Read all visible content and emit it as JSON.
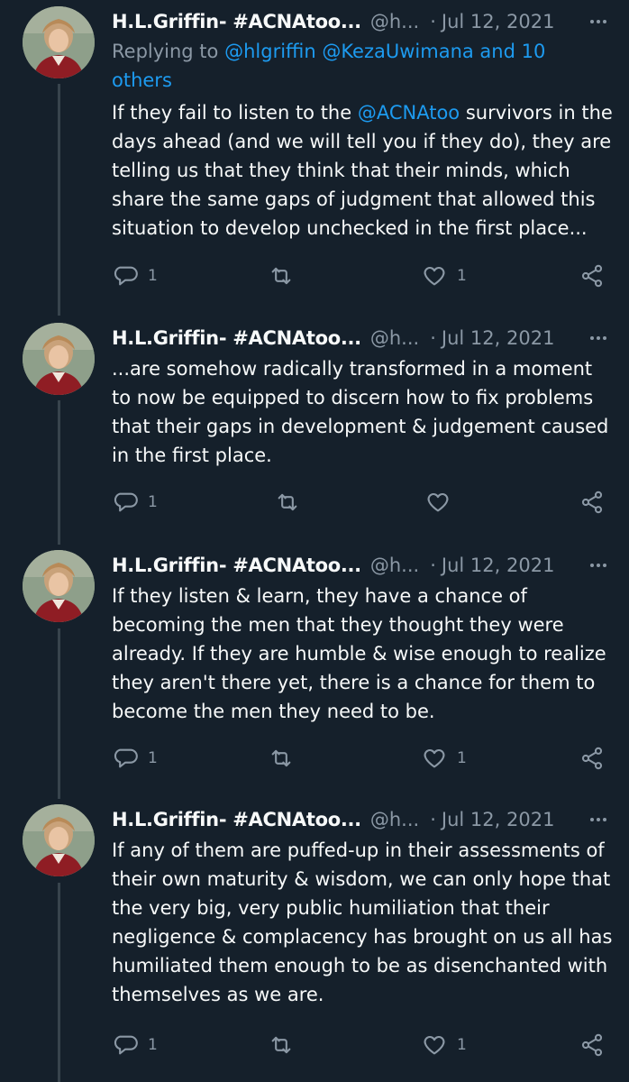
{
  "author": {
    "name": "H.L.Griffin- #ACNAtoo...",
    "handle": "@h...",
    "separator": "·",
    "date": "Jul 12, 2021"
  },
  "tweets": [
    {
      "reply_prefix": "Replying to",
      "reply_mentions": "@hlgriffin @KezaUwimana and 10 others",
      "text_before_mention": "If they fail to listen to the",
      "mention": "@ACNAtoo",
      "text_after_mention": "survivors in the days ahead (and we will tell you if they do), they are telling us that they think that their minds, which share the same gaps of judgment that allowed this situation to develop unchecked in the first place...",
      "reply_count": "1",
      "retweet_count": "",
      "like_count": "1"
    },
    {
      "text": "...are somehow radically transformed in a moment to now be equipped to discern how to fix problems that their gaps in development & judgement caused in the first place.",
      "reply_count": "1",
      "retweet_count": "",
      "like_count": ""
    },
    {
      "text": "If they listen & learn, they have a chance of becoming the men that they thought they were already. If they are humble & wise enough to realize they aren't there yet, there is a chance for them to become the men they need to be.",
      "reply_count": "1",
      "retweet_count": "",
      "like_count": "1"
    },
    {
      "text": "If any of them are puffed-up in their assessments of their own maturity & wisdom, we can only hope that the very big, very public humiliation that their negligence & complacency has brought on us all has humiliated them enough to be as disenchanted with themselves as we are.",
      "reply_count": "1",
      "retweet_count": "",
      "like_count": "1"
    }
  ],
  "icons": {
    "more": "more-horizontal-icon",
    "reply": "reply-bubble-icon",
    "retweet": "retweet-icon",
    "like": "heart-icon",
    "share": "share-icon"
  },
  "colors": {
    "background": "#15202b",
    "text": "#f7f9f9",
    "secondary": "#8b98a5",
    "link": "#1d9bf0",
    "thread_line": "#38444d"
  }
}
